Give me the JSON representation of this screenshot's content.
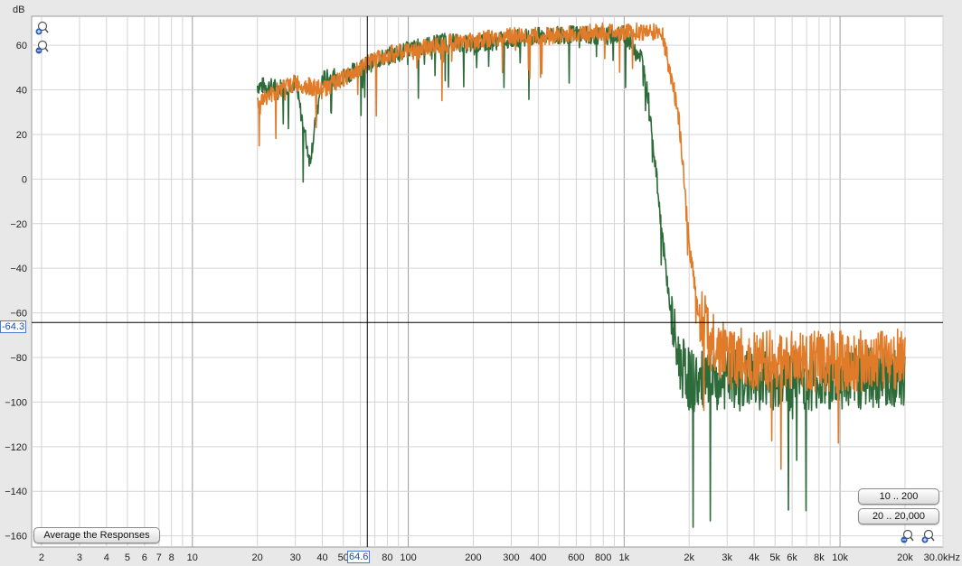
{
  "chart_data": {
    "type": "line",
    "ylabel": "dB",
    "xscale": "log",
    "xlim": [
      1.8,
      30000
    ],
    "ylim": [
      -165,
      73
    ],
    "y_ticks": [
      60,
      40,
      20,
      0,
      -20,
      -40,
      -60,
      -80,
      -100,
      -120,
      -140,
      -160
    ],
    "y_tick_labels": [
      "60",
      "40",
      "20",
      "0",
      "−20",
      "−40",
      "−60",
      "−80",
      "−100",
      "−120",
      "−140",
      "−160"
    ],
    "x_ticks": [
      2,
      3,
      4,
      5,
      6,
      7,
      8,
      10,
      20,
      30,
      40,
      50,
      80,
      100,
      200,
      300,
      400,
      600,
      800,
      1000,
      2000,
      3000,
      4000,
      5000,
      6000,
      8000,
      10000,
      20000
    ],
    "x_tick_labels": [
      "2",
      "3",
      "4",
      "5",
      "6",
      "7",
      "8",
      "10",
      "20",
      "30",
      "40",
      "50",
      "80",
      "100",
      "200",
      "300",
      "400",
      "600",
      "800",
      "1k",
      "2k",
      "3k",
      "4k",
      "5k",
      "6k",
      "8k",
      "10k",
      "20k"
    ],
    "x_end_label": "30.0kHz",
    "grid": true,
    "series": [
      {
        "color": "#2d6b3a",
        "x": [
          20,
          25,
          30,
          35,
          40,
          50,
          60,
          80,
          100,
          150,
          200,
          300,
          400,
          600,
          800,
          1000,
          1200,
          1300,
          1400,
          1500,
          1600,
          1700,
          1800,
          2000,
          2500,
          3000,
          5000,
          10000,
          20000
        ],
        "y": [
          42,
          41,
          43,
          8,
          45,
          46,
          50,
          55,
          58,
          62,
          60,
          63,
          64,
          65,
          64,
          65,
          55,
          35,
          5,
          -25,
          -50,
          -70,
          -82,
          -90,
          -92,
          -90,
          -90,
          -90,
          -88
        ]
      },
      {
        "color": "#e07b2a",
        "x": [
          20,
          25,
          30,
          40,
          50,
          60,
          80,
          100,
          150,
          200,
          300,
          400,
          600,
          800,
          1000,
          1500,
          1600,
          1700,
          1800,
          1900,
          2000,
          2200,
          2500,
          3000,
          5000,
          10000,
          20000
        ],
        "y": [
          34,
          40,
          43,
          40,
          45,
          50,
          56,
          57,
          61,
          62,
          64,
          64,
          65,
          66,
          66,
          66,
          52,
          40,
          25,
          0,
          -30,
          -58,
          -72,
          -80,
          -82,
          -82,
          -80
        ]
      }
    ],
    "cursor": {
      "x": 64.6,
      "y": -64.3,
      "x_label": "64.6",
      "y_label": "-64.3"
    }
  },
  "buttons": {
    "average": "Average the Responses",
    "range1": "10 .. 200",
    "range2": "20 .. 20,000"
  },
  "icons": {
    "zoom_in": "zoom-in-icon",
    "zoom_out": "zoom-out-icon"
  }
}
